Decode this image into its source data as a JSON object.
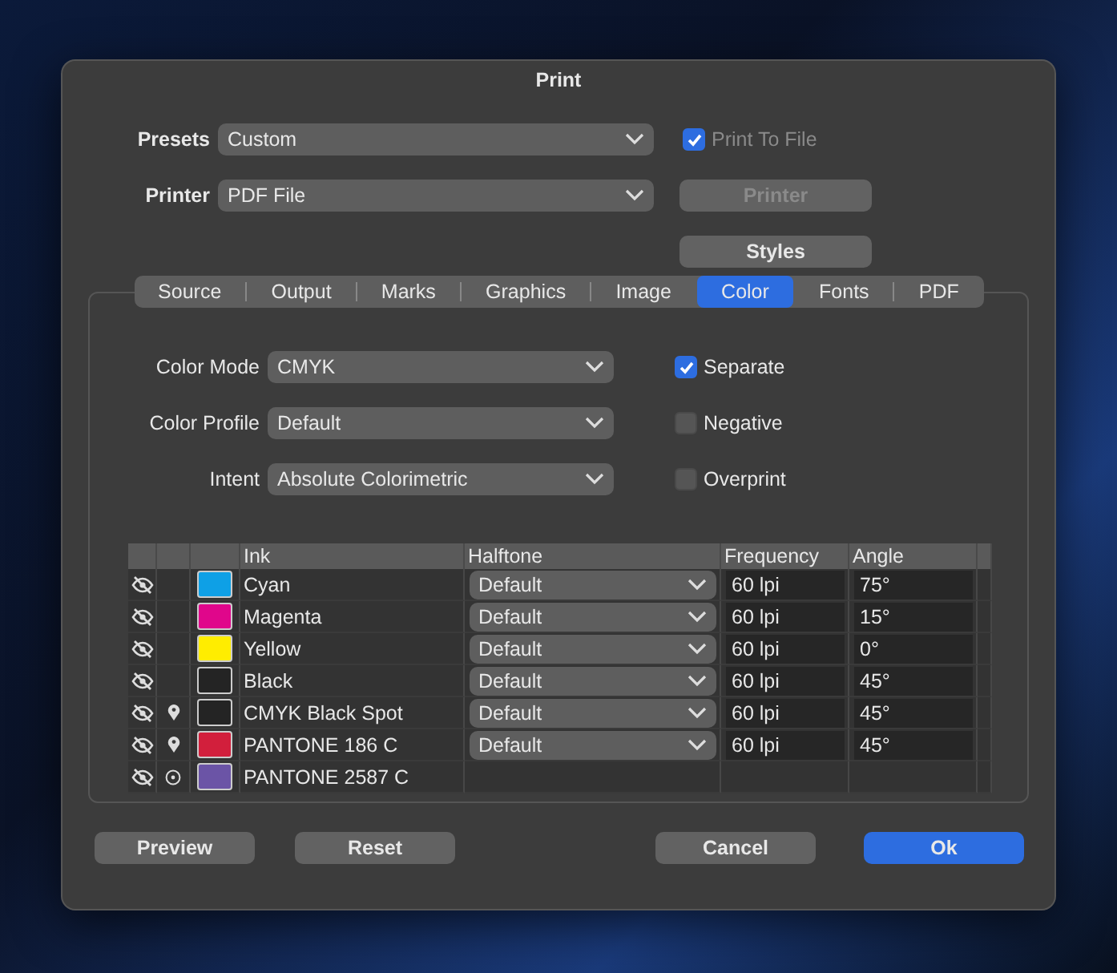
{
  "window": {
    "title": "Print"
  },
  "presets": {
    "label": "Presets",
    "value": "Custom"
  },
  "printer": {
    "label": "Printer",
    "value": "PDF File"
  },
  "print_to_file": {
    "label": "Print To File",
    "checked": true,
    "disabled": true
  },
  "printer_button": {
    "label": "Printer",
    "disabled": true
  },
  "styles_button": {
    "label": "Styles",
    "disabled": false
  },
  "tabs": [
    {
      "label": "Source",
      "selected": false
    },
    {
      "label": "Output",
      "selected": false
    },
    {
      "label": "Marks",
      "selected": false
    },
    {
      "label": "Graphics",
      "selected": false
    },
    {
      "label": "Image",
      "selected": false
    },
    {
      "label": "Color",
      "selected": true
    },
    {
      "label": "Fonts",
      "selected": false
    },
    {
      "label": "PDF",
      "selected": false
    }
  ],
  "fields": [
    {
      "label": "Color Mode",
      "value": "CMYK"
    },
    {
      "label": "Color Profile",
      "value": "Default"
    },
    {
      "label": "Intent",
      "value": "Absolute Colorimetric"
    }
  ],
  "options": [
    {
      "label": "Separate",
      "checked": true
    },
    {
      "label": "Negative",
      "checked": false
    },
    {
      "label": "Overprint",
      "checked": false
    }
  ],
  "table": {
    "columns": [
      "Ink",
      "Halftone",
      "Frequency",
      "Angle"
    ],
    "rows": [
      {
        "kind": "process",
        "color": "#0ea0e6",
        "ink": "Cyan",
        "halftone": "Default",
        "frequency": "60 lpi",
        "angle": "75°"
      },
      {
        "kind": "process",
        "color": "#e0068b",
        "ink": "Magenta",
        "halftone": "Default",
        "frequency": "60 lpi",
        "angle": "15°"
      },
      {
        "kind": "process",
        "color": "#ffed00",
        "ink": "Yellow",
        "halftone": "Default",
        "frequency": "60 lpi",
        "angle": "0°"
      },
      {
        "kind": "process",
        "color": "#242424",
        "ink": "Black",
        "halftone": "Default",
        "frequency": "60 lpi",
        "angle": "45°"
      },
      {
        "kind": "spot",
        "color": "#242424",
        "ink": "CMYK Black Spot",
        "halftone": "Default",
        "frequency": "60 lpi",
        "angle": "45°"
      },
      {
        "kind": "spot",
        "color": "#d21f3c",
        "ink": "PANTONE 186 C",
        "halftone": "Default",
        "frequency": "60 lpi",
        "angle": "45°"
      },
      {
        "kind": "target",
        "color": "#6b54a6",
        "ink": "PANTONE 2587 C"
      }
    ]
  },
  "buttons": [
    {
      "label": "Preview",
      "kind": "plain"
    },
    {
      "label": "Reset",
      "kind": "plain"
    },
    {
      "label": "Cancel",
      "kind": "plain"
    },
    {
      "label": "Ok",
      "kind": "default"
    }
  ]
}
